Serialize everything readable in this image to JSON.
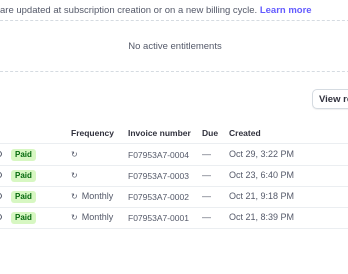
{
  "notice": {
    "text": "are updated at subscription creation or on a new billing cycle. ",
    "link": "Learn more"
  },
  "entitlements": {
    "empty_text": "No active entitlements"
  },
  "toolbar": {
    "view_label": "View re"
  },
  "table": {
    "headers": [
      "Frequency",
      "Invoice number",
      "Due",
      "Created"
    ],
    "rows": [
      {
        "status": "Paid",
        "frequency": "",
        "invoice": "F07953A7-0004",
        "due": "—",
        "created": "Oct 29, 3:22 PM"
      },
      {
        "status": "Paid",
        "frequency": "",
        "invoice": "F07953A7-0003",
        "due": "—",
        "created": "Oct 23, 6:40 PM"
      },
      {
        "status": "Paid",
        "frequency": "Monthly",
        "invoice": "F07953A7-0002",
        "due": "—",
        "created": "Oct 21, 9:18 PM"
      },
      {
        "status": "Paid",
        "frequency": "Monthly",
        "invoice": "F07953A7-0001",
        "due": "—",
        "created": "Oct 21, 8:39 PM"
      }
    ]
  },
  "icons": {
    "frequency": "refresh-icon",
    "status": "circle-icon"
  },
  "colors": {
    "link": "#635bff",
    "paid_bg": "#d7f7c2",
    "paid_text": "#05690d",
    "border": "#ebeef1"
  }
}
